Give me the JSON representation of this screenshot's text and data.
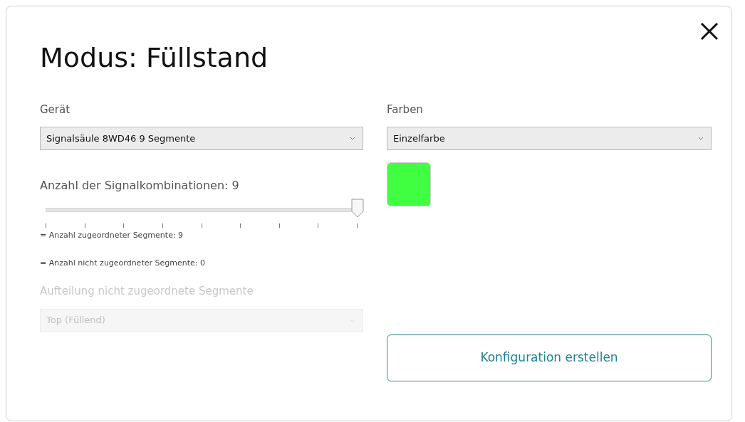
{
  "dialog": {
    "title": "Modus: Füllstand"
  },
  "device": {
    "label": "Gerät",
    "value": "Signalsäule 8WD46 9 Segmente",
    "disabled": false
  },
  "combinations": {
    "label": "Anzahl der Signalkombinationen: 9",
    "level": 1
  },
  "notes": [
    "= Anzahl zugeordneter Segmente: 9",
    "= Anzahl nicht zugeordneter Segmente: 0"
  ],
  "split": {
    "label": "Aufteilung nicht zugeordnete Segmente",
    "value": "Top (Füllend)",
    "disabled": true
  },
  "colors": {
    "label": "Farben",
    "value": "Einzelfarbe",
    "disabled": false,
    "swatch": {
      "color": "#40ff40"
    }
  },
  "create_button": {
    "label": "Konfiguration erstellen"
  }
}
